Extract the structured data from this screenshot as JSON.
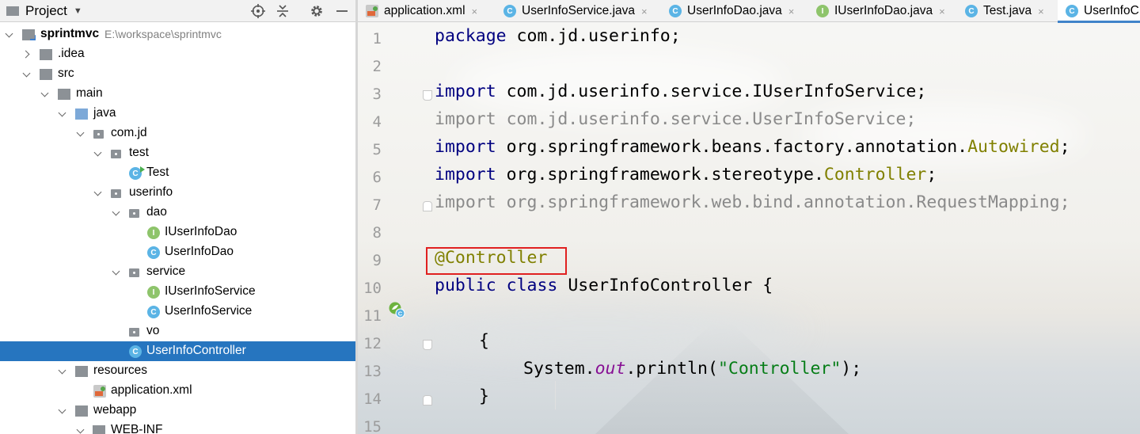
{
  "project_panel": {
    "title": "Project",
    "header_icons": [
      "crosshair-icon",
      "collapse-icon",
      "gear-icon",
      "minimize-icon"
    ],
    "tree": [
      {
        "label": "sprintmvc",
        "path": "E:\\workspace\\sprintmvc",
        "icon": "project-folder-icon",
        "state": "expanded",
        "bold": true
      },
      {
        "label": ".idea",
        "icon": "folder-icon",
        "state": "collapsed"
      },
      {
        "label": "src",
        "icon": "folder-icon",
        "state": "expanded"
      },
      {
        "label": "main",
        "icon": "folder-icon",
        "state": "expanded"
      },
      {
        "label": "java",
        "icon": "source-folder-icon",
        "state": "expanded"
      },
      {
        "label": "com.jd",
        "icon": "package-icon",
        "state": "expanded"
      },
      {
        "label": "test",
        "icon": "package-icon",
        "state": "expanded"
      },
      {
        "label": "Test",
        "icon": "runnable-class-icon",
        "state": "leaf"
      },
      {
        "label": "userinfo",
        "icon": "package-icon",
        "state": "expanded"
      },
      {
        "label": "dao",
        "icon": "package-icon",
        "state": "expanded"
      },
      {
        "label": "IUserInfoDao",
        "icon": "interface-icon",
        "state": "leaf"
      },
      {
        "label": "UserInfoDao",
        "icon": "class-icon",
        "state": "leaf"
      },
      {
        "label": "service",
        "icon": "package-icon",
        "state": "expanded"
      },
      {
        "label": "IUserInfoService",
        "icon": "interface-icon",
        "state": "leaf"
      },
      {
        "label": "UserInfoService",
        "icon": "class-icon",
        "state": "leaf"
      },
      {
        "label": "vo",
        "icon": "package-icon",
        "state": "leaf"
      },
      {
        "label": "UserInfoController",
        "icon": "class-icon",
        "state": "leaf",
        "selected": true
      },
      {
        "label": "resources",
        "icon": "resources-folder-icon",
        "state": "expanded"
      },
      {
        "label": "application.xml",
        "icon": "xml-file-icon",
        "state": "leaf"
      },
      {
        "label": "webapp",
        "icon": "web-folder-icon",
        "state": "expanded"
      },
      {
        "label": "WEB-INF",
        "icon": "folder-icon",
        "state": "expanded"
      }
    ]
  },
  "editor": {
    "tabs": [
      {
        "label": "application.xml",
        "icon": "xml-file-icon",
        "closable": true
      },
      {
        "label": "UserInfoService.java",
        "icon": "class-icon",
        "closable": true
      },
      {
        "label": "UserInfoDao.java",
        "icon": "class-icon",
        "closable": true
      },
      {
        "label": "IUserInfoDao.java",
        "icon": "interface-icon",
        "closable": true
      },
      {
        "label": "Test.java",
        "icon": "class-icon",
        "closable": true
      },
      {
        "label": "UserInfoC",
        "icon": "class-icon",
        "active": true
      }
    ],
    "close_glyph": "×",
    "line_numbers": [
      "1",
      "2",
      "3",
      "4",
      "5",
      "6",
      "7",
      "8",
      "9",
      "10",
      "11",
      "12",
      "13",
      "14",
      "15"
    ],
    "code": {
      "l1_kw": "package",
      "l1_rest": " com.jd.userinfo;",
      "l3_kw": "import",
      "l3_rest": " com.jd.userinfo.service.IUserInfoService;",
      "l4_kw": "import",
      "l4_rest": " com.jd.userinfo.service.UserInfoService;",
      "l5_kw": "import",
      "l5_mid": " org.springframework.beans.factory.annotation.",
      "l5_ann": "Autowired",
      "l5_end": ";",
      "l6_kw": "import",
      "l6_mid": " org.springframework.stereotype.",
      "l6_ann": "Controller",
      "l6_end": ";",
      "l7_kw": "import",
      "l7_rest": " org.springframework.web.bind.annotation.RequestMapping;",
      "l9_ann": "@Controller",
      "l10_kw1": "public",
      "l10_kw2": "class",
      "l10_rest": "UserInfoController {",
      "l12_text": "{",
      "l13_pre": "System.",
      "l13_fld": "out",
      "l13_mid": ".println(",
      "l13_str": "\"Controller\"",
      "l13_end": ");",
      "l14_text": "}"
    },
    "colors": {
      "keyword": "#000080",
      "annotation": "#808000",
      "string": "#067d17",
      "unused_import": "#8a8a8a",
      "selection": "#2675bf",
      "highlight_box": "#e02020"
    }
  }
}
